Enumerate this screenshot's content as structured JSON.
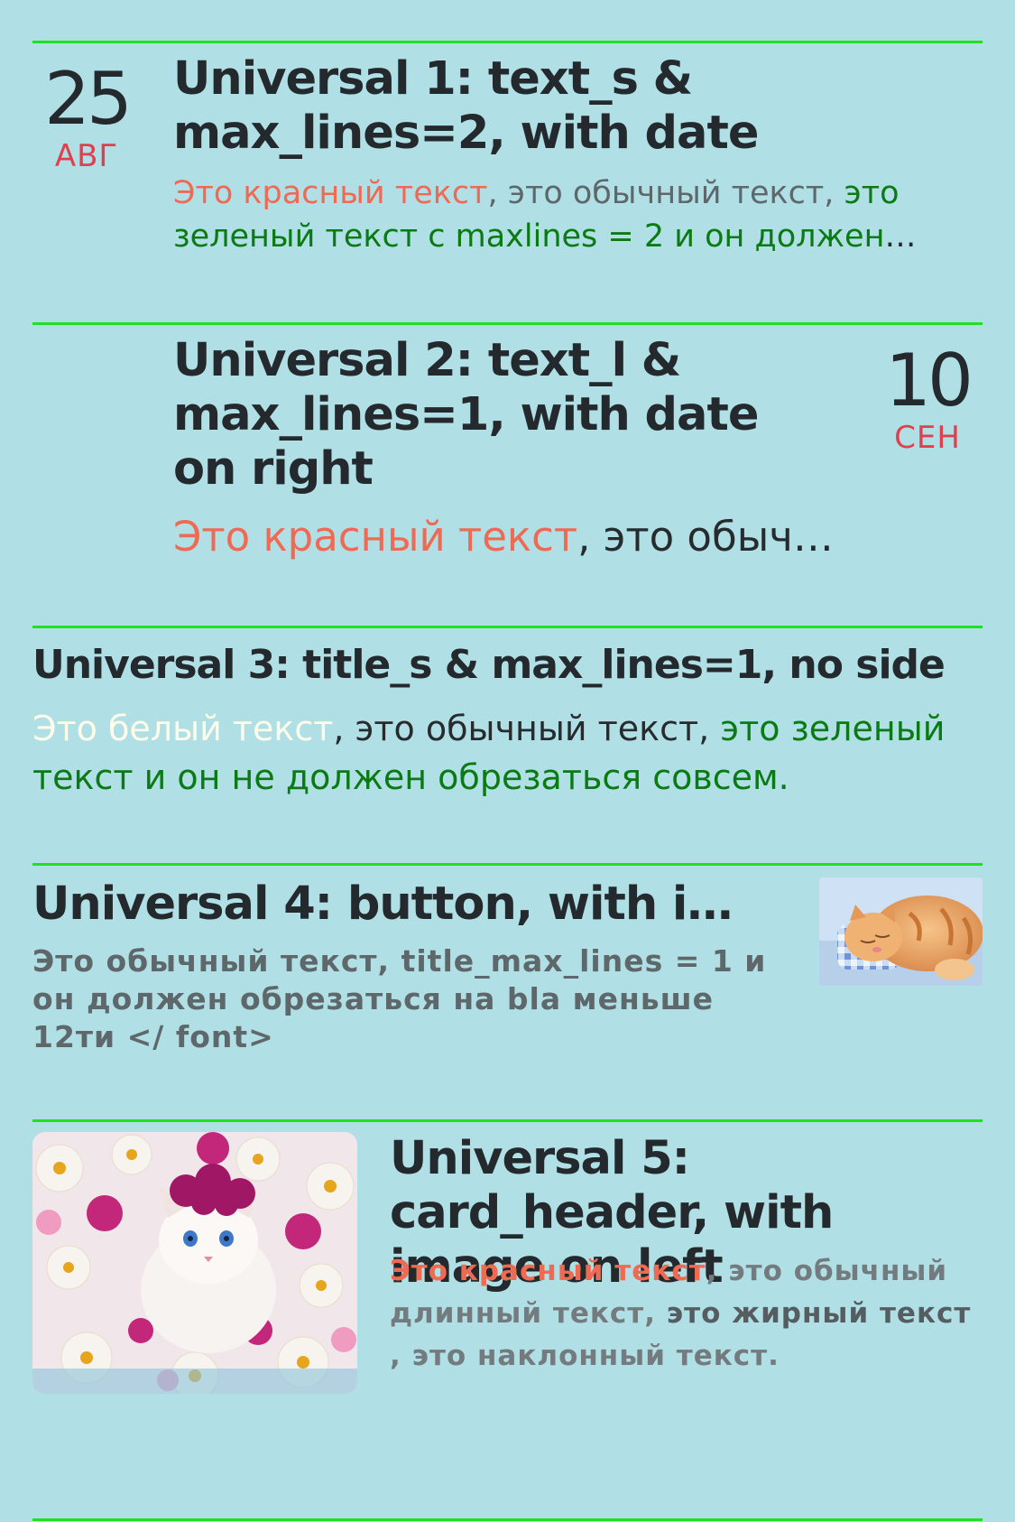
{
  "items": [
    {
      "title": "Universal 1: text_s & max_lines=2, with date",
      "date": {
        "day": "25",
        "month": "АВГ"
      },
      "text": {
        "red": "Это красный текст",
        "normal": ", это обычный текст, ",
        "green": "это зеленый текст с maxlines = 2 и он должен обрез..."
      }
    },
    {
      "title": "Universal 2: text_l & max_lines=1, with date on right",
      "date": {
        "day": "10",
        "month": "СЕН"
      },
      "text": {
        "red": "Это красный текст",
        "normal": ", это обычны..."
      }
    },
    {
      "title": "Universal 3: title_s & max_lines=1, no side",
      "text": {
        "white": "Это белый текст",
        "normal": ", это обычный текст, ",
        "green": "это зеленый текст и он не должен обрезаться совсем."
      }
    },
    {
      "title": "Universal 4: button, with image...",
      "text": "Это обычный текст, title_max_lines = 1 и он должен обрезаться на bla меньше 12ти </ font>",
      "image": "sleeping-orange-kitten-image"
    },
    {
      "title": "Universal 5: card_header, with image on left",
      "text": {
        "red": "Это красный текст",
        "normal1": ", это обычный длинный текст, ",
        "bold": "это жирный текст",
        "normal2": " , это наклонный текст."
      },
      "image": "white-kitten-with-flowers-image"
    }
  ],
  "colors": {
    "background": "#b0dfe5",
    "divider": "#21e021",
    "red": "#ef6a52",
    "green": "#0a7a12",
    "date_month": "#e0404e"
  }
}
